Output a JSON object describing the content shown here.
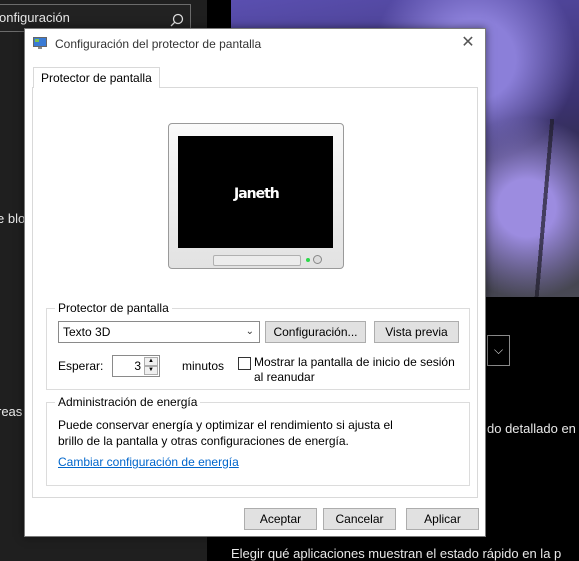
{
  "background": {
    "search_value": "onfiguración",
    "fragment_blo": "e blo",
    "fragment_reas": "reas",
    "fragment_detallado": "do detallado en",
    "fragment_bottom": "Elegir qué aplicaciones muestran el estado rápido en la p",
    "dropdown_chevron": "⌵"
  },
  "dialog": {
    "title": "Configuración del protector de pantalla",
    "close_glyph": "✕",
    "tab_label": "Protector de pantalla",
    "preview_text": "Janeth",
    "screensaver_group_label": "Protector de pantalla",
    "screensaver_selected": "Texto 3D",
    "settings_button": "Configuración...",
    "preview_button": "Vista previa",
    "wait_label": "Esperar:",
    "wait_value": "3",
    "minutes_label": "minutos",
    "logon_checkbox_label": "Mostrar la pantalla de inicio de sesión al reanudar",
    "logon_checked": false,
    "power_group_label": "Administración de energía",
    "power_description": "Puede conservar energía y optimizar el rendimiento si ajusta el brillo de la pantalla y otras configuraciones de energía.",
    "power_link": "Cambiar configuración de energía",
    "ok_button": "Aceptar",
    "cancel_button": "Cancelar",
    "apply_button": "Aplicar"
  },
  "colors": {
    "link": "#0066cc",
    "led": "#2bd84a"
  }
}
